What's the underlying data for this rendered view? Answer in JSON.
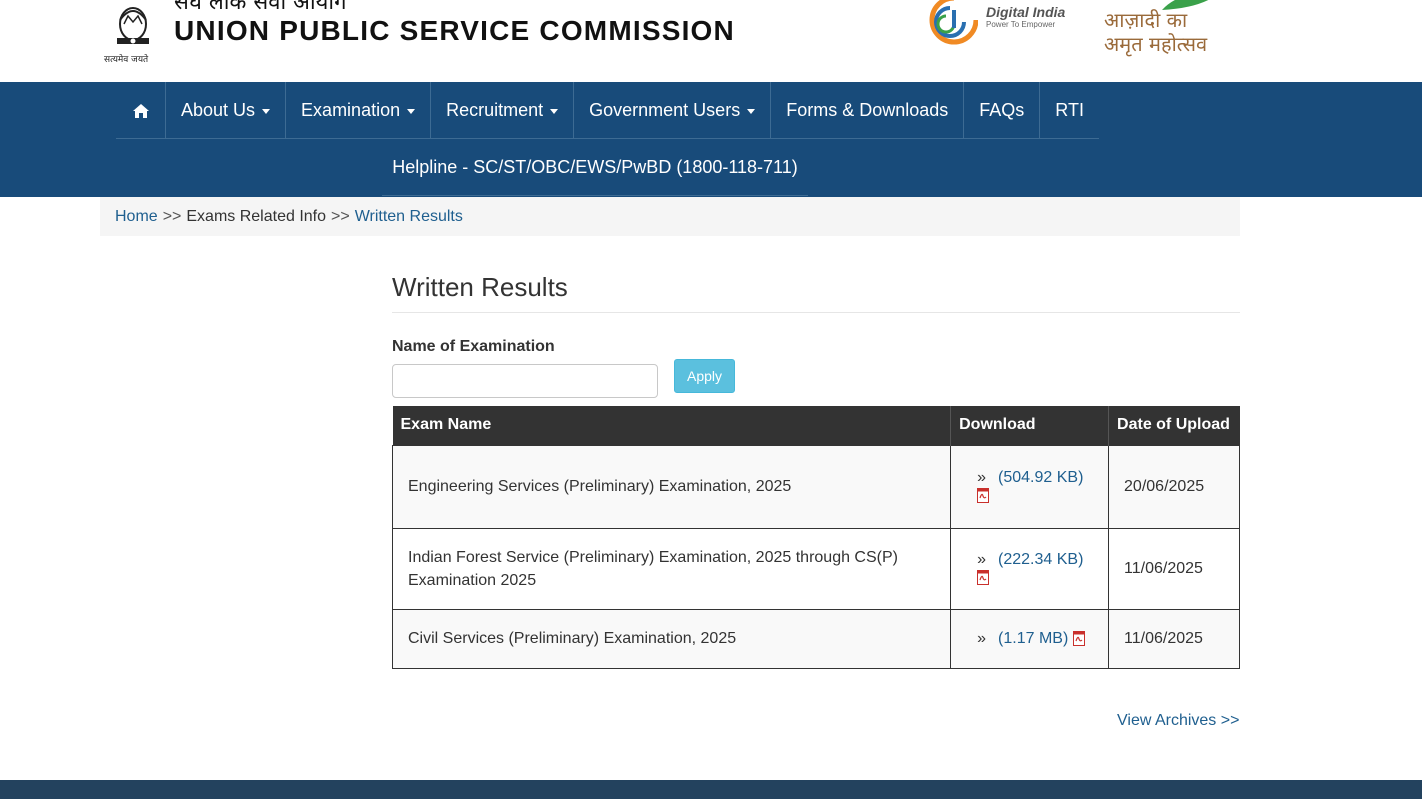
{
  "header": {
    "hindi_title": "संघ लोक सेवा आयोग",
    "org_title": "UNION PUBLIC SERVICE COMMISSION",
    "emblem_caption": "सत्यमेव जयते",
    "digital_india": "Digital India",
    "digital_india_tagline": "Power To Empower",
    "azadi_line1": "आज़ादी का",
    "azadi_line2": "अमृत महोत्सव"
  },
  "nav": {
    "items": [
      {
        "label": "",
        "icon": "home-icon"
      },
      {
        "label": "About Us"
      },
      {
        "label": "Examination"
      },
      {
        "label": "Recruitment"
      },
      {
        "label": "Government Users"
      },
      {
        "label": "Forms & Downloads"
      },
      {
        "label": "FAQs"
      },
      {
        "label": "RTI"
      }
    ],
    "helpline": "Helpline - SC/ST/OBC/EWS/PwBD (1800-118-711)"
  },
  "breadcrumb": {
    "home": "Home",
    "sep": ">>",
    "middle": "Exams Related Info",
    "current": "Written Results"
  },
  "main": {
    "title": "Written Results",
    "filter_label": "Name of Examination",
    "filter_value": "",
    "apply_label": "Apply",
    "table": {
      "headers": [
        "Exam Name",
        "Download",
        "Date of Upload"
      ],
      "rows": [
        {
          "name": "Engineering Services (Preliminary) Examination, 2025",
          "size": "(504.92 KB)",
          "date": "20/06/2025"
        },
        {
          "name": "Indian Forest Service (Preliminary) Examination, 2025 through CS(P) Examination 2025",
          "size": "(222.34 KB)",
          "date": "11/06/2025"
        },
        {
          "name": "Civil Services (Preliminary) Examination, 2025",
          "size": "(1.17 MB)",
          "date": "11/06/2025"
        }
      ]
    },
    "raquo": "»",
    "view_archives": "View Archives >>"
  },
  "colors": {
    "nav_bg": "#184b7a",
    "link": "#1f5f8f",
    "table_header_bg": "#333333",
    "apply_bg": "#5bc0de",
    "footer_bg": "#23425e"
  }
}
